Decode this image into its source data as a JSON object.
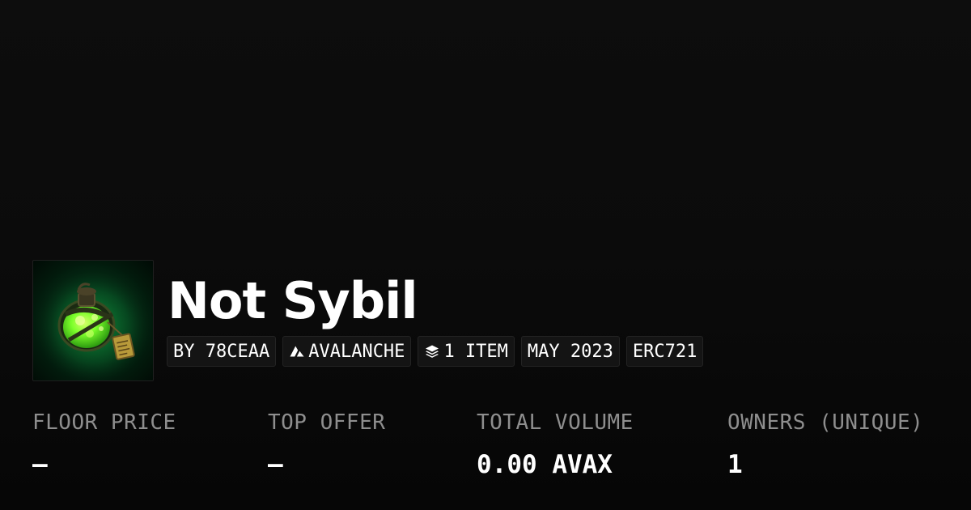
{
  "collection": {
    "name": "Not Sybil",
    "thumbnail_icon": "green-potion-bottle-image"
  },
  "tags": [
    {
      "label": "BY 78CEAA",
      "icon": null
    },
    {
      "label": "AVALANCHE",
      "icon": "avalanche-logo-icon"
    },
    {
      "label": "1 ITEM",
      "icon": "layers-icon"
    },
    {
      "label": "MAY 2023",
      "icon": null
    },
    {
      "label": "ERC721",
      "icon": null
    }
  ],
  "stats": [
    {
      "label": "FLOOR PRICE",
      "value": "—"
    },
    {
      "label": "TOP OFFER",
      "value": "—"
    },
    {
      "label": "TOTAL VOLUME",
      "value": "0.00 AVAX"
    },
    {
      "label": "OWNERS (UNIQUE)",
      "value": "1"
    }
  ],
  "colors": {
    "background": "#0b0b0b",
    "text": "#ffffff",
    "muted": "#8e8e8e",
    "tag_bg": "#141414",
    "potion_green": "#7cff2a"
  }
}
